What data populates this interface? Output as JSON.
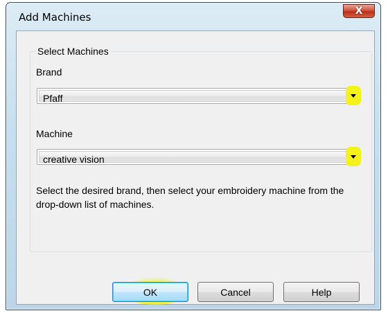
{
  "window": {
    "title": "Add Machines",
    "close_label": "X"
  },
  "group": {
    "legend": "Select Machines",
    "brand_label": "Brand",
    "brand_value": "Pfaff",
    "machine_label": "Machine",
    "machine_value": "creative vision",
    "hint": "Select the desired brand, then select your embroidery machine from the drop-down list of machines."
  },
  "buttons": {
    "ok": "OK",
    "cancel": "Cancel",
    "help": "Help"
  },
  "colors": {
    "highlight": "#f4f21a",
    "client_bg": "#f0f0f0"
  }
}
